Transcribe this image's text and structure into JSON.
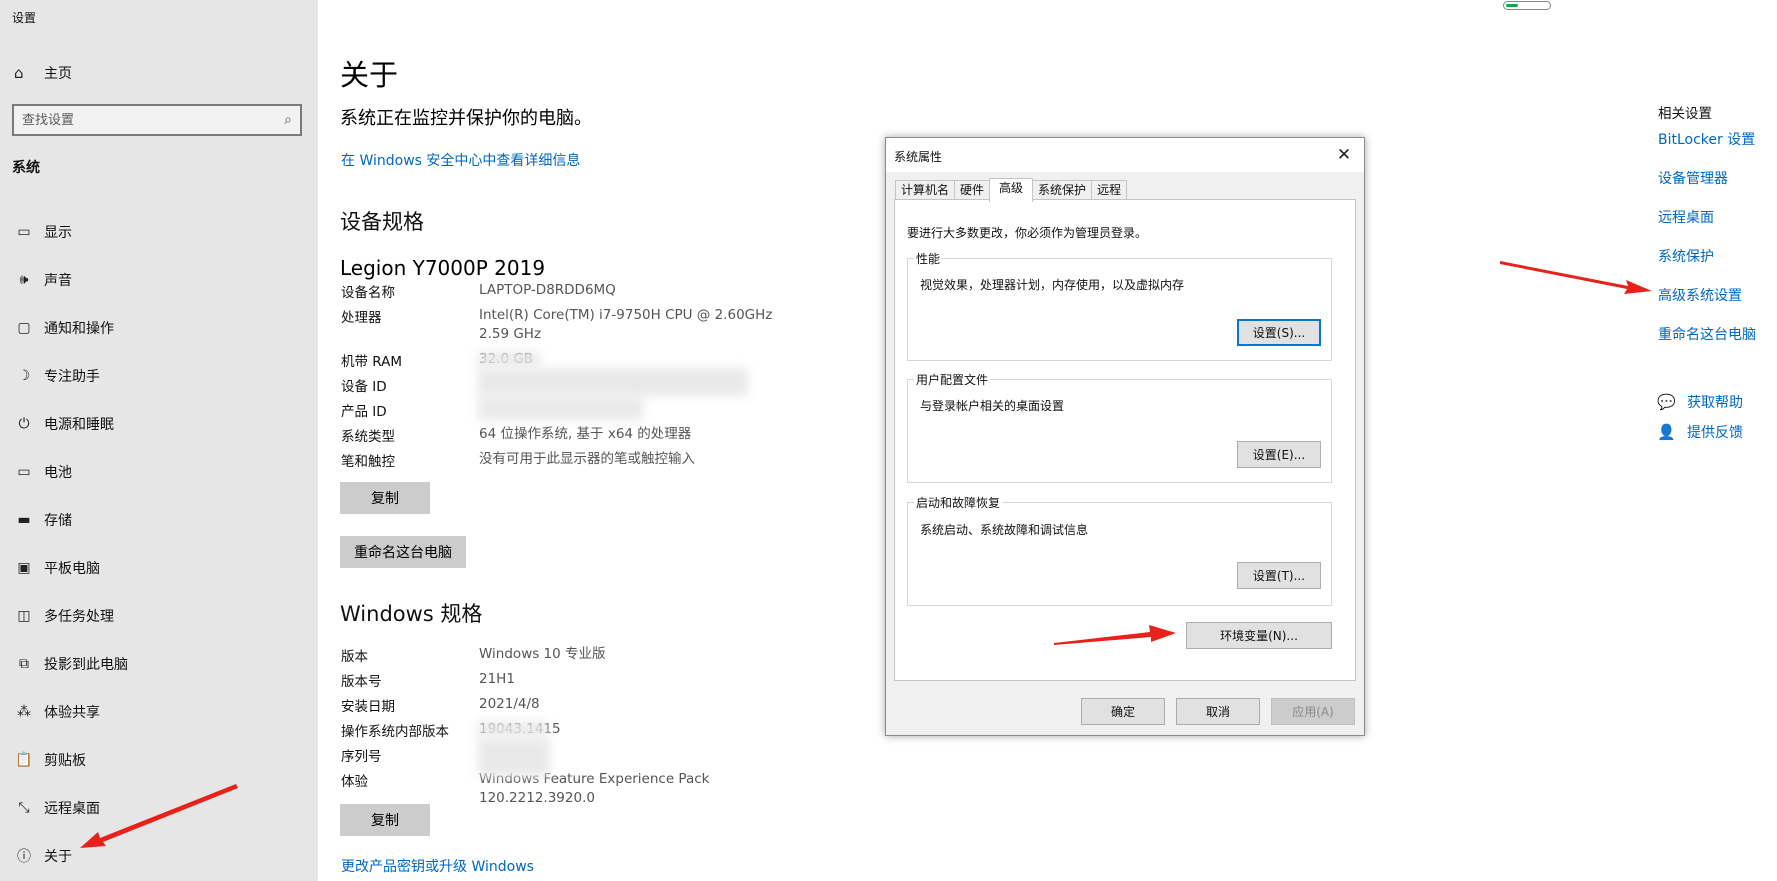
{
  "app": {
    "title": "设置"
  },
  "sidebar": {
    "home_label": "主页",
    "search_placeholder": "查找设置",
    "section": "系统",
    "items": [
      {
        "icon": "display-icon",
        "label": "显示"
      },
      {
        "icon": "sound-icon",
        "label": "声音"
      },
      {
        "icon": "notifications-icon",
        "label": "通知和操作"
      },
      {
        "icon": "focus-assist-icon",
        "label": "专注助手"
      },
      {
        "icon": "power-icon",
        "label": "电源和睡眠"
      },
      {
        "icon": "battery-icon",
        "label": "电池"
      },
      {
        "icon": "storage-icon",
        "label": "存储"
      },
      {
        "icon": "tablet-icon",
        "label": "平板电脑"
      },
      {
        "icon": "multitasking-icon",
        "label": "多任务处理"
      },
      {
        "icon": "projecting-icon",
        "label": "投影到此电脑"
      },
      {
        "icon": "shared-experiences-icon",
        "label": "体验共享"
      },
      {
        "icon": "clipboard-icon",
        "label": "剪贴板"
      },
      {
        "icon": "remote-desktop-icon",
        "label": "远程桌面"
      },
      {
        "icon": "info-icon",
        "label": "关于"
      }
    ]
  },
  "main": {
    "title": "关于",
    "protect_text": "系统正在监控并保护你的电脑。",
    "protect_link": "在 Windows 安全中心中查看详细信息",
    "device_specs_title": "设备规格",
    "device_name": "Legion Y7000P 2019",
    "device_specs": [
      {
        "key": "设备名称",
        "value": "LAPTOP-D8RDD6MQ"
      },
      {
        "key": "处理器",
        "value": "Intel(R) Core(TM) i7-9750H CPU @ 2.60GHz   2.59 GHz"
      },
      {
        "key": "机带 RAM",
        "value": "32.0 GB"
      },
      {
        "key": "设备 ID",
        "value": ""
      },
      {
        "key": "产品 ID",
        "value": ""
      },
      {
        "key": "系统类型",
        "value": "64 位操作系统, 基于 x64 的处理器"
      },
      {
        "key": "笔和触控",
        "value": "没有可用于此显示器的笔或触控输入"
      }
    ],
    "copy_button": "复制",
    "rename_button": "重命名这台电脑",
    "windows_specs_title": "Windows 规格",
    "windows_specs": [
      {
        "key": "版本",
        "value": "Windows 10 专业版"
      },
      {
        "key": "版本号",
        "value": "21H1"
      },
      {
        "key": "安装日期",
        "value": "2021/4/8"
      },
      {
        "key": "操作系统内部版本",
        "value": "19043.1415"
      },
      {
        "key": "序列号",
        "value": ""
      },
      {
        "key": "体验",
        "value": "Windows Feature Experience Pack 120.2212.3920.0"
      }
    ],
    "copy_button_2": "复制",
    "upgrade_link": "更改产品密钥或升级 Windows"
  },
  "related": {
    "title": "相关设置",
    "links": [
      "BitLocker 设置",
      "设备管理器",
      "远程桌面",
      "系统保护",
      "高级系统设置",
      "重命名这台电脑"
    ],
    "help": [
      {
        "icon": "get-help-icon",
        "label": "获取帮助"
      },
      {
        "icon": "feedback-icon",
        "label": "提供反馈"
      }
    ]
  },
  "dialog": {
    "title": "系统属性",
    "tabs": [
      "计算机名",
      "硬件",
      "高级",
      "系统保护",
      "远程"
    ],
    "active_tab": "高级",
    "admin_note": "要进行大多数更改，你必须作为管理员登录。",
    "performance": {
      "label": "性能",
      "desc": "视觉效果，处理器计划，内存使用，以及虚拟内存",
      "button": "设置(S)..."
    },
    "user_profiles": {
      "label": "用户配置文件",
      "desc": "与登录帐户相关的桌面设置",
      "button": "设置(E)..."
    },
    "startup_recovery": {
      "label": "启动和故障恢复",
      "desc": "系统启动、系统故障和调试信息",
      "button": "设置(T)..."
    },
    "env_button": "环境变量(N)...",
    "ok_button": "确定",
    "cancel_button": "取消",
    "apply_button": "应用(A)"
  },
  "colors": {
    "link": "#0067c0",
    "sidebar_bg": "#e6e6e6",
    "arrow": "#e8221b",
    "focus": "#0078d7"
  }
}
